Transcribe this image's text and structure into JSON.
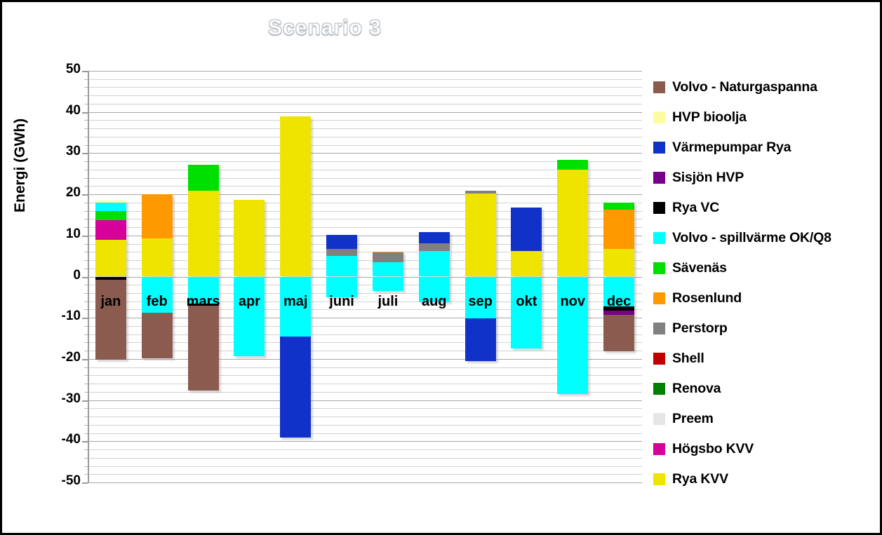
{
  "chart_data": {
    "type": "bar",
    "title": "Scenario 3",
    "subtype": "stacked-bar-diverging",
    "xlabel": "",
    "ylabel": "Energi (GWh)",
    "ylim": [
      -50,
      50
    ],
    "ytick_step": 10,
    "yminor_step": 2,
    "grid": true,
    "legend_position": "right",
    "ytick_labels": [
      "50",
      "40",
      "30",
      "20",
      "10",
      "0",
      "-10",
      "-20",
      "-30",
      "-40",
      "-50"
    ],
    "categories": [
      "jan",
      "feb",
      "mars",
      "apr",
      "maj",
      "juni",
      "juli",
      "aug",
      "sep",
      "okt",
      "nov",
      "dec"
    ],
    "series": [
      {
        "name": "Volvo - Naturgaspanna",
        "color": "#8c5b50",
        "values": [
          -19.5,
          -11.1,
          -20.5,
          0,
          0,
          0,
          0,
          0,
          0,
          0,
          0,
          -8.8
        ]
      },
      {
        "name": "HVP bioolja",
        "color": "#fbfba0",
        "values": [
          0.6,
          0,
          0,
          0,
          0,
          0,
          0,
          0,
          0,
          0,
          0,
          0
        ]
      },
      {
        "name": "Värmepumpar Rya",
        "color": "#1132c9",
        "values": [
          0,
          0,
          0,
          0,
          -24.5,
          3.3,
          0,
          2.8,
          -10.3,
          10.5,
          0,
          0
        ]
      },
      {
        "name": "Sisjön HVP",
        "color": "#76008c",
        "values": [
          0,
          0,
          0,
          0,
          0,
          0,
          0,
          0,
          0,
          0,
          0,
          -1.1
        ]
      },
      {
        "name": "Rya VC",
        "color": "#000000",
        "values": [
          -0.7,
          0,
          -0.5,
          0,
          0,
          0,
          0,
          0,
          0,
          0,
          0,
          -0.9
        ]
      },
      {
        "name": "Volvo - spillvärme OK/Q8",
        "color": "#00ffff",
        "values": [
          2.0,
          -8.7,
          -6.6,
          -19.3,
          -14.6,
          5.0,
          3.5,
          6.2,
          -10.2,
          -17.4,
          -28.5,
          -7.3
        ]
      },
      {
        "name": "Sävenäs",
        "color": "#00e000",
        "values": [
          2.2,
          0,
          6.4,
          0,
          0,
          0,
          0,
          0,
          0,
          0,
          2.4,
          1.6
        ]
      },
      {
        "name": "Rosenlund",
        "color": "#ff9900",
        "values": [
          0,
          10.7,
          0,
          0,
          0,
          0,
          0.2,
          0,
          0,
          0,
          0,
          9.5
        ]
      },
      {
        "name": "Perstorp",
        "color": "#808080",
        "values": [
          0,
          0,
          0,
          0,
          0,
          1.8,
          2.3,
          1.9,
          0.6,
          0,
          0,
          0
        ]
      },
      {
        "name": "Shell",
        "color": "#c00000",
        "values": [
          0,
          0,
          0,
          0,
          0,
          0,
          0,
          0,
          0,
          0,
          0,
          0
        ]
      },
      {
        "name": "Renova",
        "color": "#008000",
        "values": [
          0,
          0,
          0,
          0,
          0,
          0,
          0,
          0,
          0,
          0,
          0,
          0
        ]
      },
      {
        "name": "Preem",
        "color": "#e6e6e6",
        "values": [
          0,
          0,
          0,
          0,
          0,
          0,
          0,
          0,
          0,
          0,
          0,
          0
        ]
      },
      {
        "name": "Högsbo KVV",
        "color": "#d6009b",
        "values": [
          4.7,
          0,
          0,
          0,
          0,
          0,
          0,
          0,
          0,
          0,
          0,
          0
        ]
      },
      {
        "name": "Rya KVV",
        "color": "#efe400",
        "values": [
          9.0,
          9.3,
          20.8,
          18.6,
          38.9,
          0,
          0,
          0,
          20.2,
          6.2,
          26.0,
          6.8
        ]
      }
    ],
    "stack_order_positive": [
      [
        "Rya KVV",
        "Högsbo KVV",
        "Sävenäs",
        "Volvo - spillvärme OK/Q8",
        "HVP bioolja"
      ],
      [
        "Rya KVV",
        "Rosenlund"
      ],
      [
        "Rya KVV",
        "Sävenäs"
      ],
      [
        "Rya KVV"
      ],
      [
        "Rya KVV"
      ],
      [
        "Volvo - spillvärme OK/Q8",
        "Perstorp",
        "Värmepumpar Rya"
      ],
      [
        "Volvo - spillvärme OK/Q8",
        "Perstorp",
        "Rosenlund"
      ],
      [
        "Volvo - spillvärme OK/Q8",
        "Perstorp",
        "Värmepumpar Rya"
      ],
      [
        "Rya KVV",
        "Perstorp"
      ],
      [
        "Rya KVV",
        "Värmepumpar Rya"
      ],
      [
        "Rya KVV",
        "Sävenäs"
      ],
      [
        "Rya KVV",
        "Rosenlund",
        "Sävenäs"
      ]
    ],
    "stack_order_negative": [
      [
        "Rya VC",
        "Volvo - Naturgaspanna"
      ],
      [
        "Volvo - spillvärme OK/Q8",
        "Volvo - Naturgaspanna"
      ],
      [
        "Volvo - spillvärme OK/Q8",
        "Rya VC",
        "Volvo - Naturgaspanna"
      ],
      [
        "Volvo - spillvärme OK/Q8"
      ],
      [
        "Volvo - spillvärme OK/Q8",
        "Värmepumpar Rya"
      ],
      [
        "Volvo - spillvärme OK/Q8"
      ],
      [
        "Volvo - spillvärme OK/Q8"
      ],
      [
        "Volvo - spillvärme OK/Q8"
      ],
      [
        "Volvo - spillvärme OK/Q8",
        "Värmepumpar Rya"
      ],
      [
        "Volvo - spillvärme OK/Q8"
      ],
      [
        "Volvo - spillvärme OK/Q8"
      ],
      [
        "Volvo - spillvärme OK/Q8",
        "Rya VC",
        "Sisjön HVP",
        "Volvo - Naturgaspanna"
      ]
    ]
  },
  "legend": {
    "items": [
      {
        "label": "Volvo - Naturgaspanna",
        "color": "#8c5b50"
      },
      {
        "label": "HVP bioolja",
        "color": "#fbfba0"
      },
      {
        "label": "Värmepumpar Rya",
        "color": "#1132c9"
      },
      {
        "label": "Sisjön HVP",
        "color": "#76008c"
      },
      {
        "label": "Rya VC",
        "color": "#000000"
      },
      {
        "label": "Volvo - spillvärme OK/Q8",
        "color": "#00ffff"
      },
      {
        "label": "Sävenäs",
        "color": "#00e000"
      },
      {
        "label": "Rosenlund",
        "color": "#ff9900"
      },
      {
        "label": "Perstorp",
        "color": "#808080"
      },
      {
        "label": "Shell",
        "color": "#c00000"
      },
      {
        "label": "Renova",
        "color": "#008000"
      },
      {
        "label": "Preem",
        "color": "#e6e6e6"
      },
      {
        "label": "Högsbo KVV",
        "color": "#d6009b"
      },
      {
        "label": "Rya KVV",
        "color": "#efe400"
      }
    ]
  }
}
